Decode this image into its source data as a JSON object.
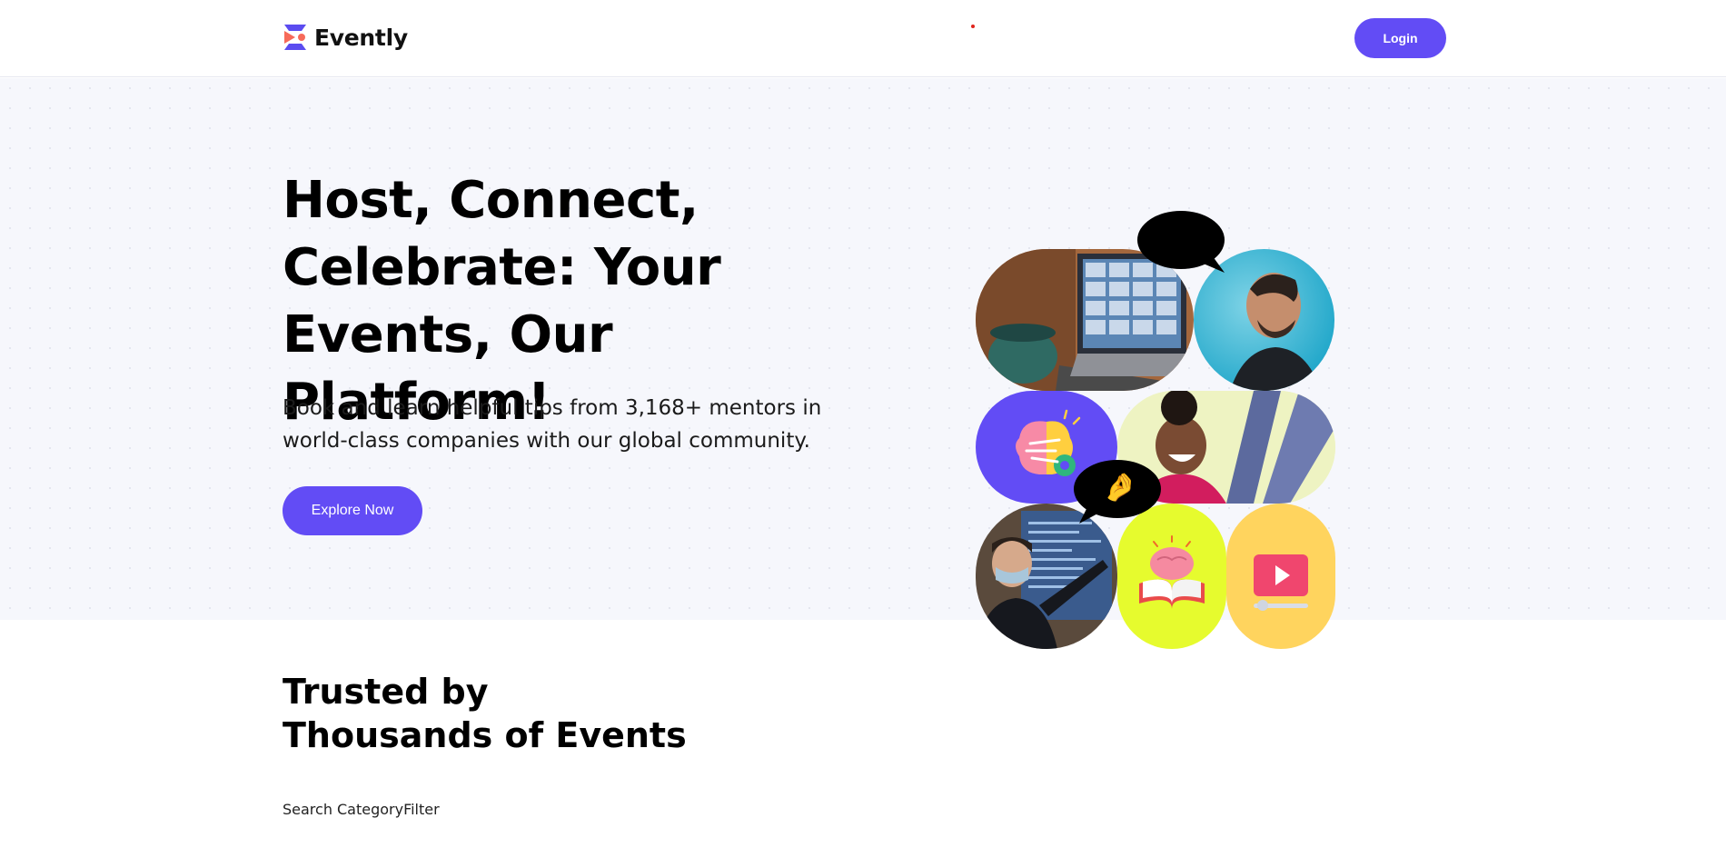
{
  "header": {
    "brand": "Evently",
    "login_label": "Login"
  },
  "hero": {
    "title": "Host, Connect, Celebrate: Your Events, Our Platform!",
    "subtitle": "Book and learn helpful tips from 3,168+ mentors in world-class companies with our global community.",
    "cta_label": "Explore Now"
  },
  "collage": {
    "emoji_love": "😍",
    "emoji_hand": "🤌"
  },
  "trusted": {
    "line1": "Trusted by",
    "line2": "Thousands of Events"
  },
  "filters": {
    "search_label": "Search",
    "category_label": "Category",
    "filter_label": "Filter"
  },
  "colors": {
    "accent": "#624cf5",
    "hero_bg": "#f6f7fc",
    "lime": "#e6fb2e",
    "yellow": "#ffd45e"
  },
  "icons": [
    "logo-icon",
    "brain-gear-icon",
    "brain-book-icon",
    "video-play-icon"
  ]
}
